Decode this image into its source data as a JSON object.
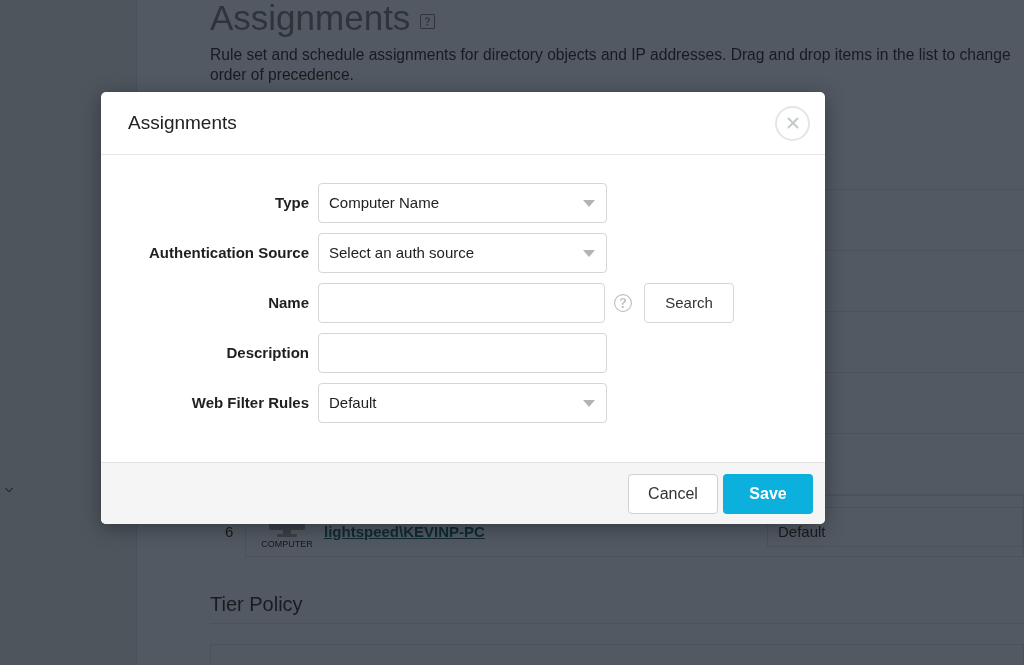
{
  "page": {
    "title": "Assignments",
    "description": "Rule set and schedule assignments for directory objects and IP addresses. Drag and drop items in the list to change order of precedence."
  },
  "assignments": [
    {
      "order": "6",
      "type": "COMPUTER",
      "name": "lightspeed\\KEVINP-PC",
      "rule": "Default"
    }
  ],
  "sections": [
    {
      "title": "Tier Policy"
    }
  ],
  "dialog": {
    "title": "Assignments",
    "fields": [
      {
        "label": "Type",
        "kind": "select",
        "value": "Computer Name"
      },
      {
        "label": "Authentication Source",
        "kind": "select",
        "value": "Select an auth source"
      },
      {
        "label": "Name",
        "kind": "search",
        "action": "Search"
      },
      {
        "label": "Description",
        "kind": "text"
      },
      {
        "label": "Web Filter Rules",
        "kind": "select",
        "value": "Default"
      }
    ],
    "buttons": [
      {
        "label": "Cancel",
        "kind": "secondary"
      },
      {
        "label": "Save",
        "kind": "primary"
      }
    ]
  }
}
